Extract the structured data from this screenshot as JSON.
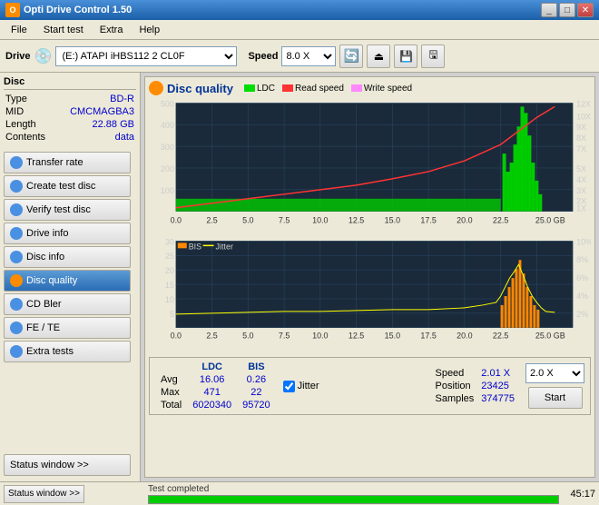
{
  "window": {
    "title": "Opti Drive Control 1.50",
    "icon": "O"
  },
  "menu": {
    "items": [
      "File",
      "Start test",
      "Extra",
      "Help"
    ]
  },
  "toolbar": {
    "drive_label": "Drive",
    "drive_value": "(E:)  ATAPI iHBS112  2 CL0F",
    "speed_label": "Speed",
    "speed_value": "8.0 X"
  },
  "sidebar": {
    "disc_section_title": "Disc",
    "disc_info": [
      {
        "key": "Type",
        "value": "BD-R"
      },
      {
        "key": "MID",
        "value": "CMCMAGBA3"
      },
      {
        "key": "Length",
        "value": "22.88 GB"
      },
      {
        "key": "Contents",
        "value": "data"
      }
    ],
    "buttons": [
      {
        "label": "Transfer rate",
        "icon": "blue",
        "active": false
      },
      {
        "label": "Create test disc",
        "icon": "blue",
        "active": false
      },
      {
        "label": "Verify test disc",
        "icon": "blue",
        "active": false
      },
      {
        "label": "Drive info",
        "icon": "blue",
        "active": false
      },
      {
        "label": "Disc info",
        "icon": "blue",
        "active": false
      },
      {
        "label": "Disc quality",
        "icon": "orange",
        "active": true
      },
      {
        "label": "CD Bler",
        "icon": "blue",
        "active": false
      },
      {
        "label": "FE / TE",
        "icon": "blue",
        "active": false
      },
      {
        "label": "Extra tests",
        "icon": "blue",
        "active": false
      }
    ],
    "status_window_btn": "Status window >>",
    "test_completed": "Test completed"
  },
  "disc_quality": {
    "title": "Disc quality",
    "legend": [
      {
        "label": "LDC",
        "color": "#00cc00"
      },
      {
        "label": "Read speed",
        "color": "#ff4444"
      },
      {
        "label": "Write speed",
        "color": "#ff88ff"
      }
    ],
    "chart_top": {
      "y_axis_left": [
        "500",
        "400",
        "300",
        "200",
        "100"
      ],
      "y_axis_right": [
        "12X",
        "10X",
        "9X",
        "8X",
        "7X",
        "5X",
        "4X",
        "3X",
        "2X",
        "1X"
      ],
      "x_axis": [
        "0.0",
        "2.5",
        "5.0",
        "7.5",
        "10.0",
        "12.5",
        "15.0",
        "17.5",
        "20.0",
        "22.5",
        "25.0 GB"
      ]
    },
    "chart_bottom": {
      "title_bis": "BIS",
      "title_jitter": "Jitter",
      "y_axis_left": [
        "30",
        "25",
        "20",
        "15",
        "10",
        "5"
      ],
      "y_axis_right": [
        "10%",
        "8%",
        "6%",
        "4%",
        "2%"
      ],
      "x_axis": [
        "0.0",
        "2.5",
        "5.0",
        "7.5",
        "10.0",
        "12.5",
        "15.0",
        "17.5",
        "20.0",
        "22.5",
        "25.0 GB"
      ]
    },
    "stats": {
      "columns": [
        "",
        "LDC",
        "BIS"
      ],
      "rows": [
        {
          "label": "Avg",
          "ldc": "16.06",
          "bis": "0.26"
        },
        {
          "label": "Max",
          "ldc": "471",
          "bis": "22"
        },
        {
          "label": "Total",
          "ldc": "6020340",
          "bis": "95720"
        }
      ],
      "jitter_label": "Jitter",
      "jitter_checked": true,
      "speed_label": "Speed",
      "speed_value": "2.01 X",
      "position_label": "Position",
      "position_value": "23425",
      "samples_label": "Samples",
      "samples_value": "374775",
      "speed_select": "2.0 X",
      "start_btn": "Start"
    }
  },
  "status_bar": {
    "status_window_label": "Status window >>",
    "test_completed": "Test completed",
    "progress": 100,
    "time": "45:17"
  },
  "colors": {
    "ldc_green": "#00dd00",
    "read_red": "#ff3333",
    "write_pink": "#ff88ff",
    "bis_orange": "#ff8800",
    "jitter_yellow": "#ffff00",
    "grid_line": "#2a4a6a",
    "chart_bg": "#1a2a3a"
  }
}
